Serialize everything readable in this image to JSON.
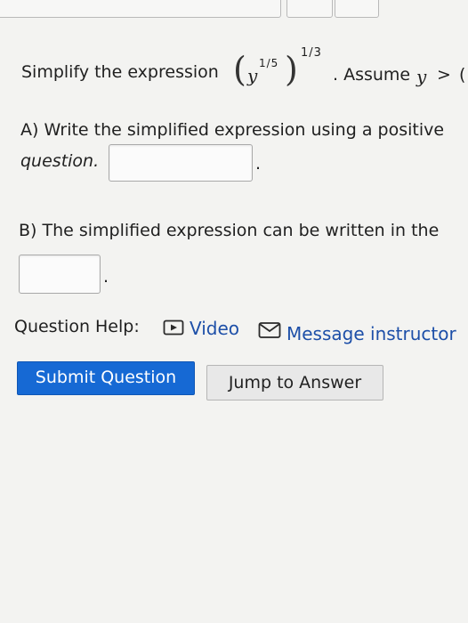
{
  "question": {
    "prefix": "Simplify the expression",
    "base_var": "y",
    "inner_exponent": "1/5",
    "outer_exponent": "1/3",
    "open_paren": "(",
    "close_paren": ")",
    "assume_label": ". Assume",
    "assume_var": "y",
    "assume_op": ">",
    "assume_tail": "("
  },
  "part_a": {
    "line1": "A) Write the simplified expression using a positive",
    "line2": "question.",
    "after_box": "."
  },
  "part_b": {
    "line1": "B) The simplified expression can be written in the",
    "after_box": "."
  },
  "help": {
    "label": "Question Help:",
    "video_label": "Video",
    "message_label": "Message instructor"
  },
  "buttons": {
    "submit_label": "Submit Question",
    "jump_label": "Jump to Answer"
  },
  "colors": {
    "submit_bg": "#1669d4",
    "link": "#1d4fa8"
  }
}
